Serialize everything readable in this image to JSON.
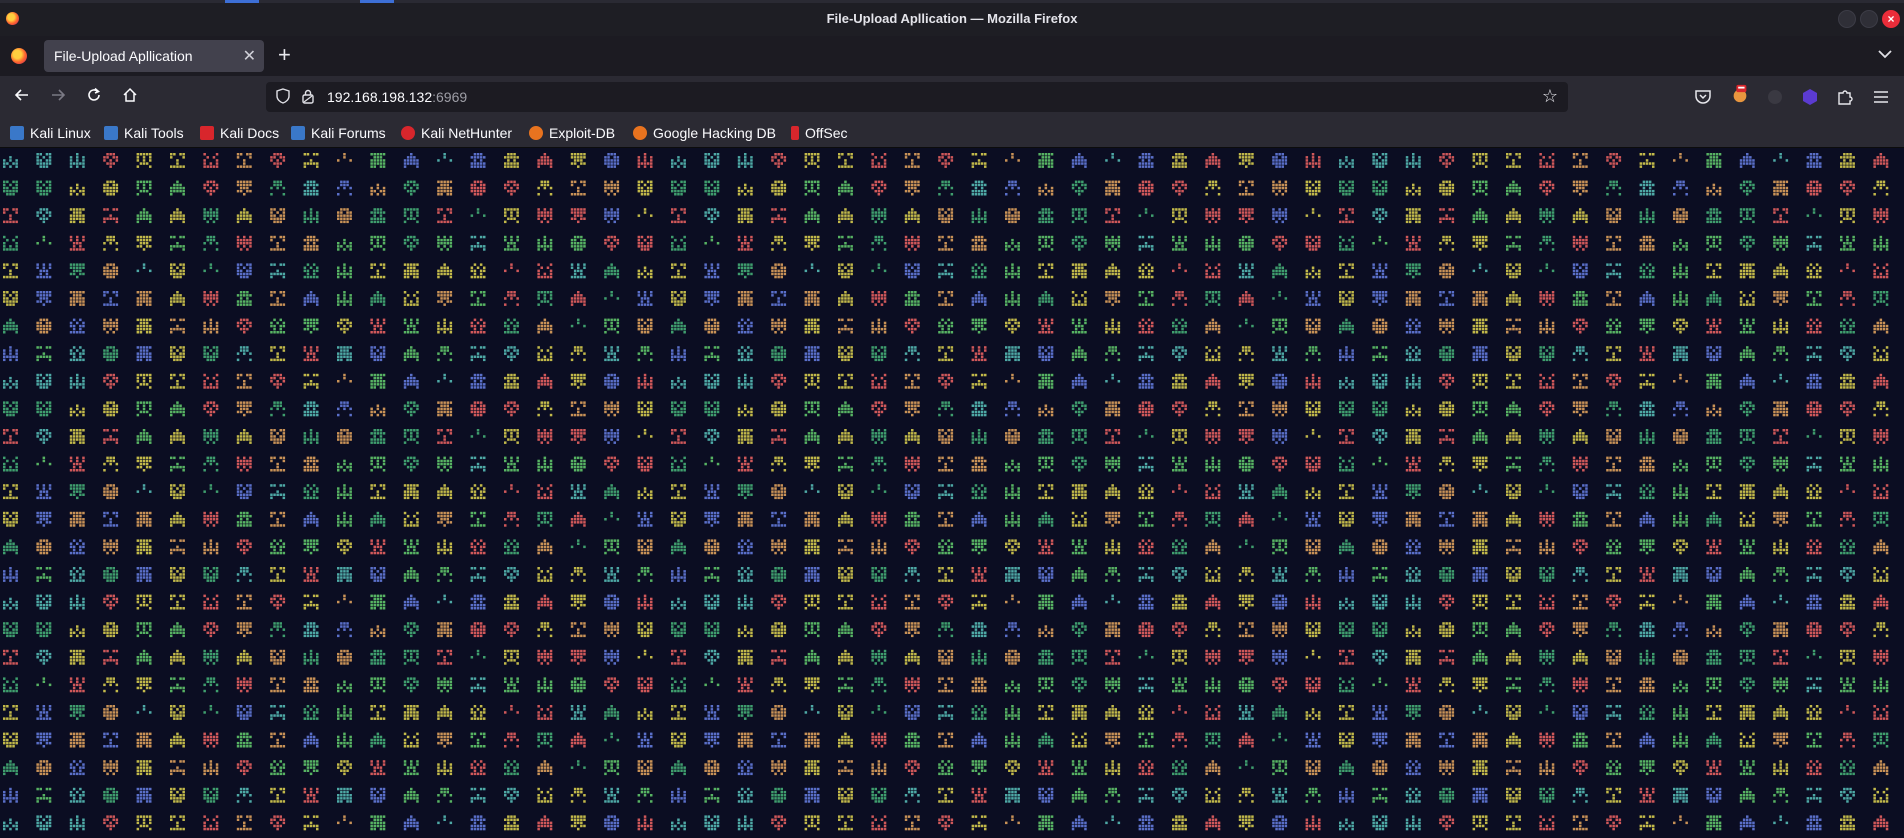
{
  "window": {
    "title": "File-Upload Apllication — Mozilla Firefox",
    "close_glyph": "×"
  },
  "tabs": [
    {
      "label": "File-Upload Apllication",
      "active": true
    }
  ],
  "toolbar": {
    "back_icon": "arrow-left-icon",
    "forward_icon": "arrow-right-icon",
    "reload_icon": "reload-icon",
    "home_icon": "home-icon",
    "new_tab_glyph": "+",
    "list_tabs_glyph": "⌄"
  },
  "urlbar": {
    "host": "192.168.198.132",
    "port": ":6969",
    "bookmark_star": "☆"
  },
  "bookmarks": [
    {
      "label": "Kali Linux",
      "color": "#3a78c9"
    },
    {
      "label": "Kali Tools",
      "color": "#3a78c9"
    },
    {
      "label": "Kali Docs",
      "color": "#d8262c"
    },
    {
      "label": "Kali Forums",
      "color": "#3a78c9"
    },
    {
      "label": "Kali NetHunter",
      "color": "#d8262c"
    },
    {
      "label": "Exploit-DB",
      "color": "#e8731f"
    },
    {
      "label": "Google Hacking DB",
      "color": "#e8731f"
    },
    {
      "label": "OffSec",
      "color": "#d8262c"
    }
  ],
  "page": {
    "background": "#0b0d22",
    "palette": [
      "#57b363",
      "#c2b94a",
      "#5a6fc9",
      "#c99257",
      "#4ea9a6",
      "#d0585a",
      "#3f9e6e"
    ]
  }
}
